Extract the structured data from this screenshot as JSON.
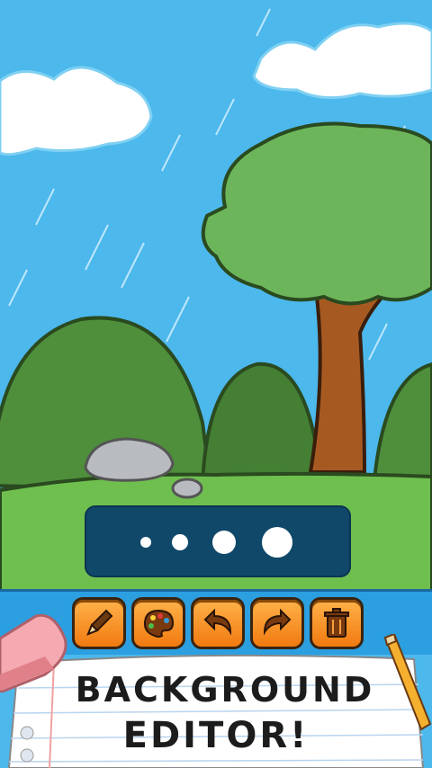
{
  "title": {
    "line1": "BACKGROUND",
    "line2": "EDITOR!"
  },
  "toolbar": {
    "tools": [
      {
        "name": "pencil",
        "icon": "pencil-icon"
      },
      {
        "name": "palette",
        "icon": "palette-icon"
      },
      {
        "name": "undo",
        "icon": "undo-icon"
      },
      {
        "name": "redo",
        "icon": "redo-icon"
      },
      {
        "name": "trash",
        "icon": "trash-icon"
      }
    ]
  },
  "brush_sizes": [
    "small",
    "medium",
    "large",
    "extra-large"
  ],
  "colors": {
    "sky": "#4cb8ec",
    "panel": "#10486a",
    "toolbar": "#2b9fe0",
    "button": "#f59a2a",
    "grass": "#6fbf4f",
    "hill": "#4f8f3c"
  }
}
